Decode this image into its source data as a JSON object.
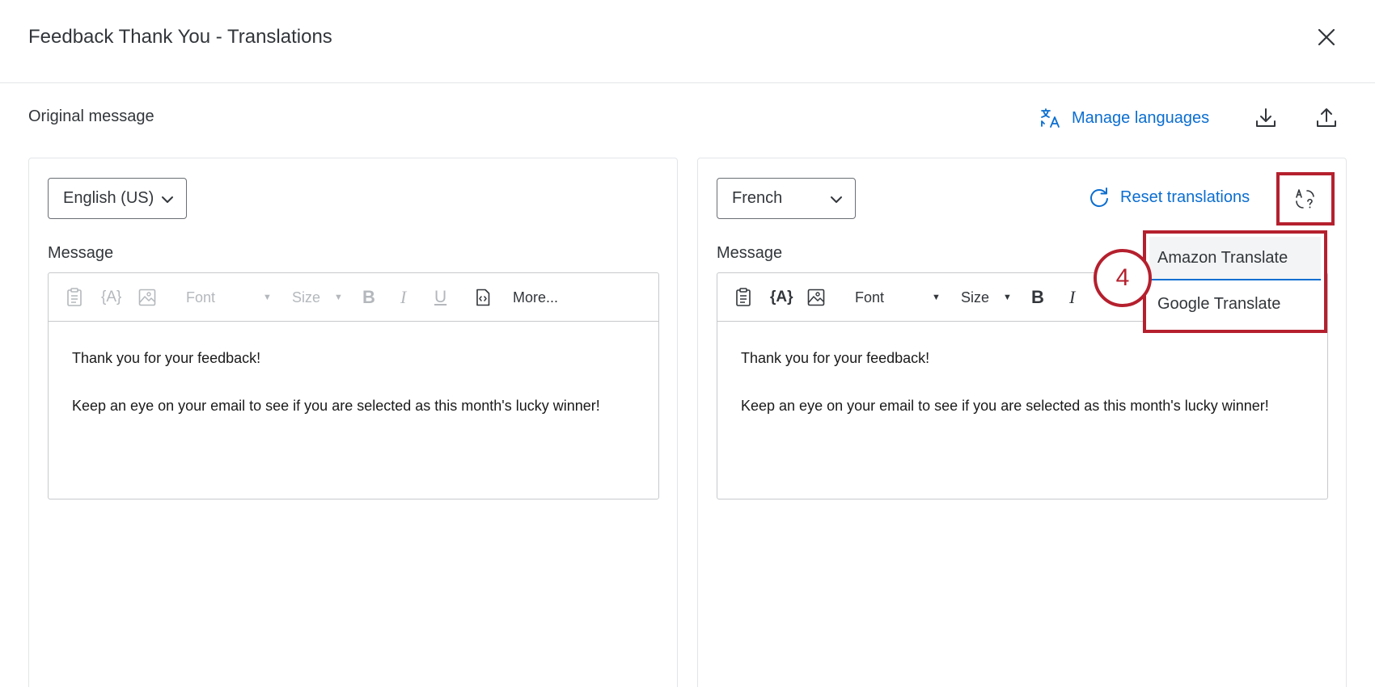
{
  "dialog": {
    "title": "Feedback Thank You - Translations"
  },
  "subheader": {
    "original_label": "Original message",
    "manage_languages": "Manage languages"
  },
  "left_panel": {
    "language": "English (US)",
    "message_label": "Message",
    "toolbar": {
      "font": "Font",
      "size": "Size",
      "bold": "B",
      "italic": "I",
      "underline": "U",
      "more": "More...",
      "piped_text": "{A}"
    },
    "body": {
      "line1": "Thank you for your feedback!",
      "line2": "Keep an eye on your email to see if you are selected as this month's lucky winner!"
    }
  },
  "right_panel": {
    "language": "French",
    "reset_label": "Reset translations",
    "message_label": "Message",
    "toolbar": {
      "font": "Font",
      "size": "Size",
      "bold": "B",
      "italic": "I",
      "piped_text": "{A}"
    },
    "body": {
      "line1": "Thank you for your feedback!",
      "line2": "Keep an eye on your email to see if you are selected as this month's lucky winner!"
    }
  },
  "translate_menu": {
    "items": [
      "Amazon Translate",
      "Google Translate"
    ]
  },
  "annotation": {
    "step_number": "4"
  },
  "colors": {
    "accent_blue": "#0b6ed0",
    "highlight_red": "#b5202e",
    "text": "#32363a"
  }
}
